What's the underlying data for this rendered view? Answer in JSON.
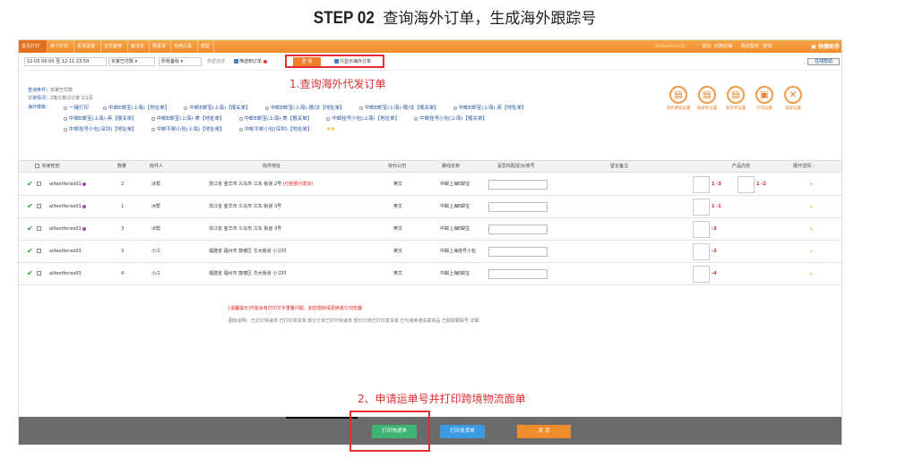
{
  "step": {
    "num": "STEP 02",
    "title": "查询海外订单，生成海外跟踪号"
  },
  "topbar": {
    "tabs": [
      "首页打印",
      "单个打印",
      "发货设置",
      "宝贝备称",
      "备注本",
      "预发货",
      "实用工具",
      "帮助"
    ],
    "right_items": [
      "dlixiaofoixi02",
      "退出",
      "切换店铺",
      "购买服务",
      "咨询"
    ],
    "quick_help": "快捷助手"
  },
  "filter": {
    "date_range": "12-05 00:00 至 12-11 23:59",
    "status": "买家已付款",
    "flag": "所有备标",
    "hint": "数据选择",
    "filter_check": "筛选到订单",
    "query_button": "查 询",
    "only_overseas": "只显示海外订单",
    "online_help": "在线帮助"
  },
  "info": {
    "query_label": "查询条件：",
    "query_value": "买家已付款",
    "summary_label": "订单情况：",
    "summary_value": "2笔订单/2订单  1/1页",
    "template_label": "海外模板：",
    "templates_row1": [
      "一键打印",
      "中邮E邮宝(上海)【地址单】",
      "中邮E邮宝(上海)【报关单】",
      "中邮E邮宝(上海)-德/法【地址单】",
      "中邮E邮宝(上海)-德/法【报关单】",
      "中邮E邮宝(上海)-英【地址单】"
    ],
    "templates_row2": [
      "中邮E邮宝(上海)-英【报关单】",
      "中邮E邮宝(上海)-美【地址单】",
      "中邮E邮宝(上海)-美【报关单】",
      "中邮挂号小包(上海)【地址单】",
      "中邮挂号小包(上海)【报关单】"
    ],
    "templates_row3": [
      "中邮挂号小包(深圳)【地址单】",
      "中邮平邮小包(上海)【地址单】",
      "中邮平邮小包(深圳)【地址单】"
    ],
    "annotation": "1.查询海外代发订单"
  },
  "icons": [
    {
      "name": "海外模板设置",
      "glyph": "▤"
    },
    {
      "name": "快递单设置",
      "glyph": "▤"
    },
    {
      "name": "发货单设置",
      "glyph": "▤"
    },
    {
      "name": "打印设置",
      "glyph": "▣"
    },
    {
      "name": "高级设置",
      "glyph": "✕"
    }
  ],
  "table": {
    "headers": [
      "买家旺旺",
      "数量",
      "收件人",
      "收件地址",
      "快代公司",
      "路线名称",
      "是否匹配成功/单号",
      "留言备注",
      "产品内容",
      "展开详情"
    ],
    "rows": [
      {
        "buyer": "alitestforiso01",
        "qty": "2",
        "recv": "冰帮",
        "addr": "浙江省 金华市 义乌市 江东 街道 2号",
        "addr_note": "(已经部分发货)",
        "co": "英文",
        "route": "中邮上海E邮宝",
        "p1": "1 -3",
        "p2": "1 -2",
        "dot": true
      },
      {
        "buyer": "alitestforiso01",
        "qty": "1",
        "recv": "冰帮",
        "addr": "浙江省 金华市 义乌市 江东 街道 3号",
        "addr_note": "",
        "co": "英文",
        "route": "中邮上海E邮宝",
        "p1": "1 -1",
        "p2": "",
        "dot": true
      },
      {
        "buyer": "alitestforiso01",
        "qty": "3",
        "recv": "冰帮",
        "addr": "浙江省 金华市 义乌市 江东 街道 3号",
        "addr_note": "",
        "co": "英文",
        "route": "中邮上海E邮宝",
        "p1": "-3",
        "p2": "",
        "dot": true
      },
      {
        "buyer": "alitestforiso03",
        "qty": "3",
        "recv": "小江",
        "addr": "福建省 福州市 鼓楼区 华大街道 小江村",
        "addr_note": "",
        "co": "英文",
        "route": "中邮上海挂号小包",
        "p1": "-3",
        "p2": "",
        "dot": false
      },
      {
        "buyer": "alitestforiso03",
        "qty": "4",
        "recv": "小江",
        "addr": "福建省 福州市 鼓楼区 华大街道 小江村",
        "addr_note": "",
        "co": "英文",
        "route": "中邮上海E邮宝",
        "p1": "-4",
        "p2": "",
        "dot": false
      }
    ]
  },
  "notes": {
    "line1": "[温馨提示]可能会有打印文字重叠问题，如您遇到请更换其它浏览器",
    "line2": "图标说明：已打印快递单 已打印发货单 部分订单已打印快递单 部分订单已打印发货单 已与速卖通关联商品 已获取跟踪号 详细"
  },
  "annotation2": "2、申请运单号并打印跨境物流面单",
  "buttons": {
    "print_express": "打印快递单",
    "print_delivery": "打印发货单",
    "ship": "发 货"
  },
  "colors": {
    "orange": "#ef8d2c",
    "red": "#e62e2e",
    "green": "#3cb371",
    "blue": "#3a9be0"
  }
}
